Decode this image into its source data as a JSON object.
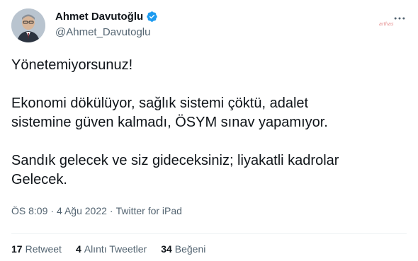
{
  "author": {
    "display_name": "Ahmet Davutoğlu",
    "handle": "@Ahmet_Davutoglu",
    "verified": true
  },
  "watermark": "arthas",
  "tweet": {
    "paragraphs": [
      "Yönetemiyorsunuz!",
      "Ekonomi dökülüyor, sağlık sistemi çöktü, adalet\nsistemine güven kalmadı, ÖSYM sınav yapamıyor.",
      "Sandık gelecek ve siz gideceksiniz; liyakatli kadrolar\nGelecek."
    ]
  },
  "meta": {
    "time": "ÖS 8:09",
    "separator": "·",
    "date": "4 Ağu 2022",
    "source": "Twitter for iPad"
  },
  "stats": {
    "retweets": {
      "count": "17",
      "label": "Retweet"
    },
    "quotes": {
      "count": "4",
      "label": "Alıntı Tweetler"
    },
    "likes": {
      "count": "34",
      "label": "Beğeni"
    }
  },
  "colors": {
    "verified_blue": "#1d9bf0",
    "secondary_text": "#536471",
    "primary_text": "#0f1419"
  },
  "icons": {
    "more": "more-horizontal-icon",
    "verified": "verified-badge-icon"
  }
}
